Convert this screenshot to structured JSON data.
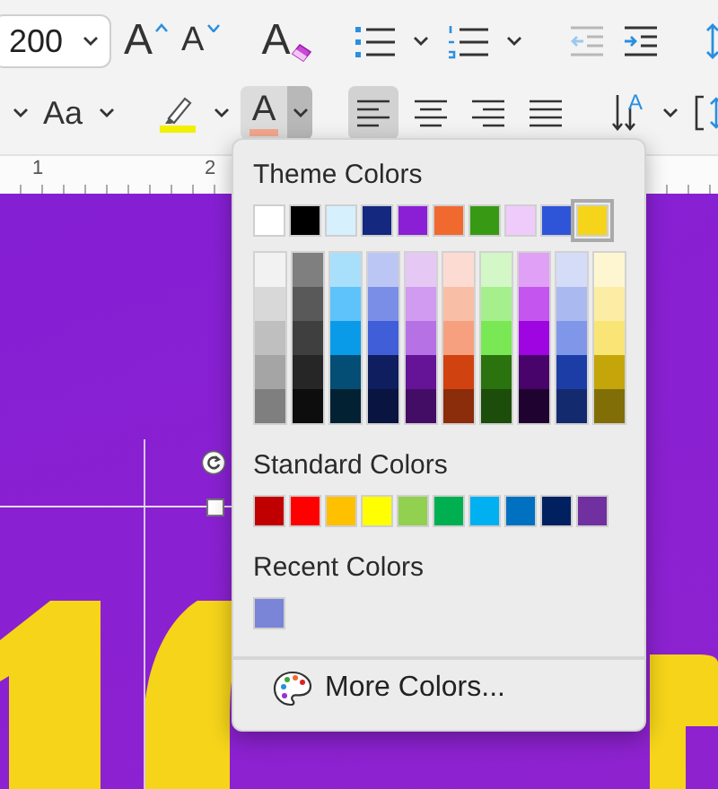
{
  "ribbon": {
    "row1": [
      [
        {
          "kind": "font-size",
          "value": "200"
        },
        {
          "kind": "grow-font",
          "label": "A"
        },
        {
          "kind": "shrink-font",
          "label": "A"
        }
      ],
      [
        {
          "kind": "clear-format",
          "label": "A"
        }
      ],
      [
        {
          "kind": "bullets",
          "menu": true
        },
        {
          "kind": "numbering",
          "menu": true
        }
      ],
      [
        {
          "kind": "decrease-indent",
          "disabled": true
        },
        {
          "kind": "increase-indent",
          "disabled": false
        }
      ],
      [
        {
          "kind": "line-spacing"
        }
      ]
    ],
    "row2": [
      [
        {
          "kind": "menu-only"
        },
        {
          "kind": "change-case",
          "label": "Aa",
          "menu": true
        }
      ],
      [
        {
          "kind": "highlight",
          "color": "#f2f000",
          "menu": true
        },
        {
          "kind": "font-color",
          "label": "A",
          "color": "#f4a88e",
          "menu": true,
          "open": true
        }
      ],
      [
        {
          "kind": "align-left",
          "selected": true
        },
        {
          "kind": "align-center",
          "selected": false
        },
        {
          "kind": "align-right",
          "selected": false
        },
        {
          "kind": "justify",
          "selected": false
        }
      ],
      [
        {
          "kind": "text-direction",
          "label": "A",
          "menu": true
        },
        {
          "kind": "resize"
        }
      ]
    ]
  },
  "ruler": {
    "labels": [
      "1",
      "2"
    ]
  },
  "color_menu": {
    "theme_title": "Theme Colors",
    "theme_colors": [
      {
        "color": "#ffffff",
        "selected": false
      },
      {
        "color": "#000000",
        "selected": false
      },
      {
        "color": "#d6f0fd",
        "selected": false
      },
      {
        "color": "#13287e",
        "selected": false
      },
      {
        "color": "#8a1fd6",
        "selected": false
      },
      {
        "color": "#f06a30",
        "selected": false
      },
      {
        "color": "#389a14",
        "selected": false
      },
      {
        "color": "#efcbfb",
        "selected": false
      },
      {
        "color": "#2e55d8",
        "selected": false
      },
      {
        "color": "#f5d41a",
        "selected": true
      }
    ],
    "shades": [
      [
        {
          "color": "#f2f2f2"
        },
        {
          "color": "#d8d8d8"
        },
        {
          "color": "#bfbfbf"
        },
        {
          "color": "#a5a5a5"
        },
        {
          "color": "#7f7f7f"
        }
      ],
      [
        {
          "color": "#7f7f7f"
        },
        {
          "color": "#595959"
        },
        {
          "color": "#3f3f3f"
        },
        {
          "color": "#262626"
        },
        {
          "color": "#0d0d0d"
        }
      ],
      [
        {
          "color": "#a8e0fc"
        },
        {
          "color": "#5ec3fa"
        },
        {
          "color": "#0a9be8"
        },
        {
          "color": "#044d75"
        },
        {
          "color": "#022233"
        }
      ],
      [
        {
          "color": "#bcc6f4"
        },
        {
          "color": "#7a8ee8"
        },
        {
          "color": "#3f5ed8"
        },
        {
          "color": "#0f1e5f"
        },
        {
          "color": "#0a1440"
        }
      ],
      [
        {
          "color": "#e6c8f5"
        },
        {
          "color": "#d09bf0"
        },
        {
          "color": "#b672e5"
        },
        {
          "color": "#661497"
        },
        {
          "color": "#440d65"
        }
      ],
      [
        {
          "color": "#fcdcd2"
        },
        {
          "color": "#f9bea6"
        },
        {
          "color": "#f6a07f"
        },
        {
          "color": "#d14211"
        },
        {
          "color": "#8b2c0b"
        }
      ],
      [
        {
          "color": "#d3f7c6"
        },
        {
          "color": "#a5ef8d"
        },
        {
          "color": "#79e854"
        },
        {
          "color": "#2a730f"
        },
        {
          "color": "#1c4d0a"
        }
      ],
      [
        {
          "color": "#e0a0f5"
        },
        {
          "color": "#c455ee"
        },
        {
          "color": "#9e05e0"
        },
        {
          "color": "#48046a"
        },
        {
          "color": "#200230"
        }
      ],
      [
        {
          "color": "#d5dcf7"
        },
        {
          "color": "#aab9ef"
        },
        {
          "color": "#8096e8"
        },
        {
          "color": "#1d3da6"
        },
        {
          "color": "#132a6f"
        }
      ],
      [
        {
          "color": "#fdf6d1"
        },
        {
          "color": "#fbeda3"
        },
        {
          "color": "#f9e576"
        },
        {
          "color": "#c4a60a"
        },
        {
          "color": "#816e07"
        }
      ]
    ],
    "standard_title": "Standard Colors",
    "standard_colors": [
      {
        "color": "#c00000"
      },
      {
        "color": "#ff0000"
      },
      {
        "color": "#ffc000"
      },
      {
        "color": "#ffff00"
      },
      {
        "color": "#92d050"
      },
      {
        "color": "#00b050"
      },
      {
        "color": "#00b0f0"
      },
      {
        "color": "#0070c0"
      },
      {
        "color": "#002060"
      },
      {
        "color": "#7030a0"
      }
    ],
    "recent_title": "Recent Colors",
    "recent_colors": [
      {
        "color": "#7a85d8"
      }
    ],
    "more_label": "More Colors..."
  }
}
